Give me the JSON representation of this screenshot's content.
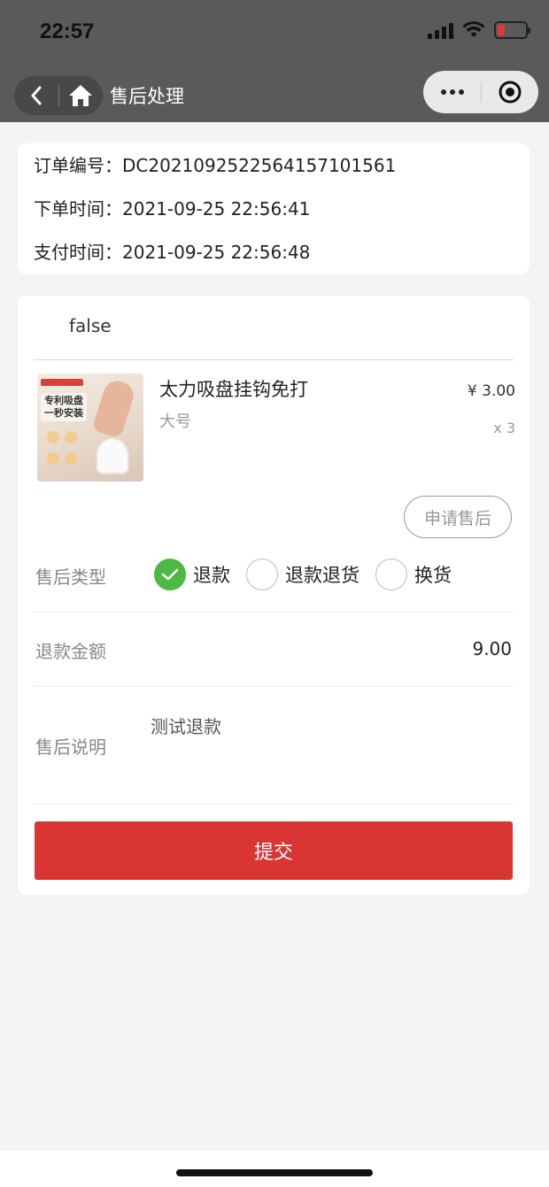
{
  "status_bar": {
    "time": "22:57"
  },
  "navbar": {
    "title": "售后处理"
  },
  "order": {
    "number_line": "订单编号：DC202109252256415710156​1",
    "created_line": "下单时间：2021-09-25 22:56:41",
    "paid_line": "支付时间：2021-09-25 22:56:48"
  },
  "store": {
    "name": "false"
  },
  "product": {
    "name": "太力吸盘挂钩免打",
    "spec": "大号",
    "price": "¥ 3.00",
    "quantity": "x 3",
    "thumb_text": "专利吸盘\n一秒安装"
  },
  "actions": {
    "apply_label": "申请售后",
    "submit_label": "提交"
  },
  "after_sale": {
    "type_label": "售后类型",
    "types": [
      {
        "label": "退款",
        "checked": true
      },
      {
        "label": "退款退货",
        "checked": false
      },
      {
        "label": "换货",
        "checked": false
      }
    ],
    "amount_label": "退款金额",
    "amount_value": "9.00",
    "desc_label": "售后说明",
    "desc_value": "测试退款"
  },
  "colors": {
    "accent_red": "#d93532",
    "check_green": "#4cb944",
    "header": "#5a5a5a"
  }
}
